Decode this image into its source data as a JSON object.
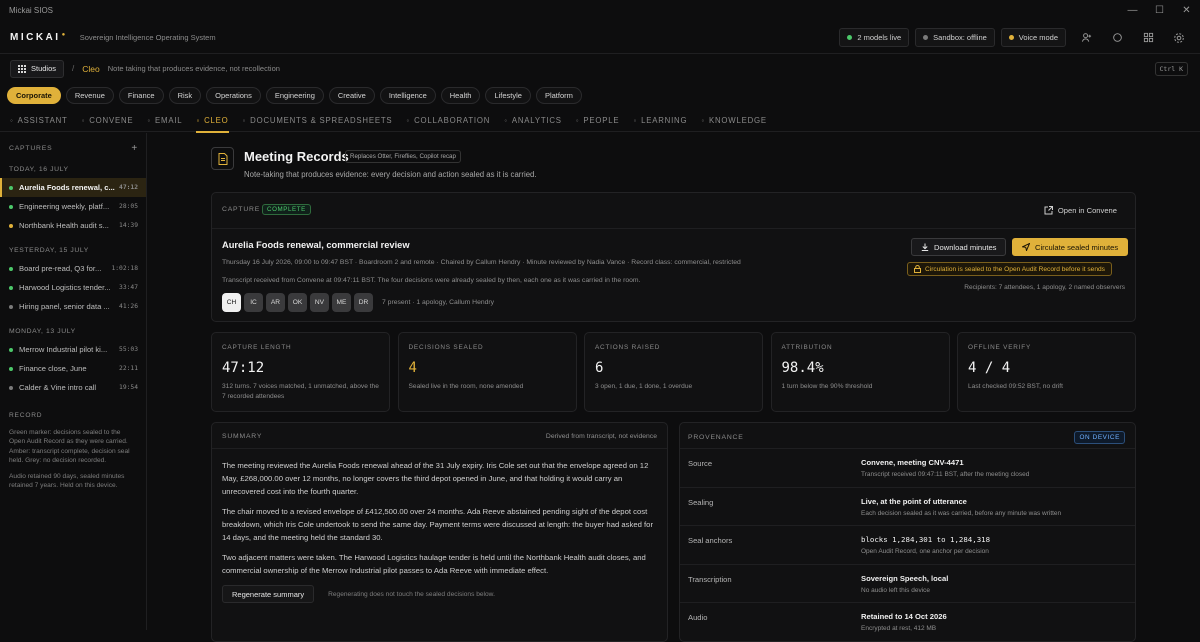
{
  "window": {
    "title": "Mickai SIOS"
  },
  "header": {
    "logo": "MICKAI",
    "tagline": "Sovereign Intelligence Operating System",
    "status": {
      "models": "2 models live",
      "sandbox": "Sandbox: offline",
      "voice": "Voice mode"
    }
  },
  "breadcrumb": {
    "studios": "Studios",
    "current": "Cleo",
    "description": "Note taking that produces evidence, not recollection",
    "shortcut": "Ctrl K"
  },
  "categories": [
    "Corporate",
    "Revenue",
    "Finance",
    "Risk",
    "Operations",
    "Engineering",
    "Creative",
    "Intelligence",
    "Health",
    "Lifestyle",
    "Platform"
  ],
  "active_category": "Corporate",
  "tabs": [
    "ASSISTANT",
    "CONVENE",
    "EMAIL",
    "CLEO",
    "DOCUMENTS & SPREADSHEETS",
    "COLLABORATION",
    "ANALYTICS",
    "PEOPLE",
    "LEARNING",
    "KNOWLEDGE"
  ],
  "active_tab": "CLEO",
  "sidebar": {
    "title": "CAPTURES",
    "groups": [
      {
        "day": "TODAY, 16 JULY",
        "items": [
          {
            "title": "Aurelia Foods renewal, c...",
            "time": "47:12",
            "status": "green",
            "active": true
          },
          {
            "title": "Engineering weekly, platf...",
            "time": "28:05",
            "status": "green"
          },
          {
            "title": "Northbank Health audit s...",
            "time": "14:39",
            "status": "amber"
          }
        ]
      },
      {
        "day": "YESTERDAY, 15 JULY",
        "items": [
          {
            "title": "Board pre-read, Q3 for...",
            "time": "1:02:18",
            "status": "green"
          },
          {
            "title": "Harwood Logistics tender...",
            "time": "33:47",
            "status": "green"
          },
          {
            "title": "Hiring panel, senior data ...",
            "time": "41:26",
            "status": "grey"
          }
        ]
      },
      {
        "day": "MONDAY, 13 JULY",
        "items": [
          {
            "title": "Merrow Industrial pilot ki...",
            "time": "55:03",
            "status": "green"
          },
          {
            "title": "Finance close, June",
            "time": "22:11",
            "status": "green"
          },
          {
            "title": "Calder & Vine intro call",
            "time": "19:54",
            "status": "grey"
          }
        ]
      }
    ],
    "record": {
      "title": "RECORD",
      "legend": "Green marker: decisions sealed to the Open Audit Record as they were carried. Amber: transcript complete, decision seal held. Grey: no decision recorded.",
      "retention": "Audio retained 90 days, sealed minutes retained 7 years. Held on this device."
    }
  },
  "page": {
    "title": "Meeting Records",
    "tag": "Replaces Otter, Fireflies, Copilot recap",
    "subtitle": "Note-taking that produces evidence: every decision and action sealed as it is carried."
  },
  "capture": {
    "label": "CAPTURE",
    "badge": "COMPLETE",
    "open_link": "Open in Convene",
    "title": "Aurelia Foods renewal, commercial review",
    "meta": "Thursday 16 July 2026, 09:00 to 09:47 BST · Boardroom 2 and remote · Chaired by Callum Hendry · Minute reviewed by Nadia Vance · Record class: commercial, restricted",
    "note": "Transcript received from Convene at 09:47:11 BST. The four decisions were already sealed by then, each one as it was carried in the room.",
    "attendees": [
      "CH",
      "IC",
      "AR",
      "OK",
      "NV",
      "ME",
      "DR"
    ],
    "attendance_note": "7 present · 1 apology, Callum Hendry",
    "download_label": "Download minutes",
    "circulate_label": "Circulate sealed minutes",
    "lock_note": "Circulation is sealed to the Open Audit Record before it sends",
    "recipients": "Recipients: 7 attendees, 1 apology, 2 named observers"
  },
  "stats": [
    {
      "label": "CAPTURE LENGTH",
      "value": "47:12",
      "note": "312 turns. 7 voices matched, 1 unmatched, above the 7 recorded attendees",
      "amber": false
    },
    {
      "label": "DECISIONS SEALED",
      "value": "4",
      "note": "Sealed live in the room, none amended",
      "amber": true
    },
    {
      "label": "ACTIONS RAISED",
      "value": "6",
      "note": "3 open, 1 due, 1 done, 1 overdue",
      "amber": false
    },
    {
      "label": "ATTRIBUTION",
      "value": "98.4%",
      "note": "1 turn below the 90% threshold",
      "amber": false
    },
    {
      "label": "OFFLINE VERIFY",
      "value": "4 / 4",
      "note": "Last checked 09:52 BST, no drift",
      "amber": false
    }
  ],
  "summary": {
    "label": "SUMMARY",
    "derived": "Derived from transcript, not evidence",
    "paragraphs": [
      "The meeting reviewed the Aurelia Foods renewal ahead of the 31 July expiry. Iris Cole set out that the envelope agreed on 12 May, £268,000.00 over 12 months, no longer covers the third depot opened in June, and that holding it would carry an unrecovered cost into the fourth quarter.",
      "The chair moved to a revised envelope of £412,500.00 over 24 months. Ada Reeve abstained pending sight of the depot cost breakdown, which Iris Cole undertook to send the same day. Payment terms were discussed at length: the buyer had asked for 14 days, and the meeting held the standard 30.",
      "Two adjacent matters were taken. The Harwood Logistics haulage tender is held until the Northbank Health audit closes, and commercial ownership of the Merrow Industrial pilot passes to Ada Reeve with immediate effect."
    ],
    "regen_label": "Regenerate summary",
    "regen_note": "Regenerating does not touch the sealed decisions below."
  },
  "provenance": {
    "label": "PROVENANCE",
    "badge": "ON DEVICE",
    "rows": [
      {
        "key": "Source",
        "value": "Convene, meeting CNV-4471",
        "sub": "Transcript received 09:47:11 BST, after the meeting closed"
      },
      {
        "key": "Sealing",
        "value": "Live, at the point of utterance",
        "sub": "Each decision sealed as it was carried, before any minute was written"
      },
      {
        "key": "Seal anchors",
        "value": "blocks 1,284,301 to 1,284,318",
        "sub": "Open Audit Record, one anchor per decision",
        "mono": true
      },
      {
        "key": "Transcription",
        "value": "Sovereign Speech, local",
        "sub": "No audio left this device"
      },
      {
        "key": "Audio",
        "value": "Retained to 14 Oct 2026",
        "sub": "Encrypted at rest, 412 MB"
      }
    ]
  },
  "colors": {
    "accent": "#e0b13a",
    "green": "#4cc86a",
    "grey": "#7a7a7a",
    "blue": "#6fb0ff"
  }
}
